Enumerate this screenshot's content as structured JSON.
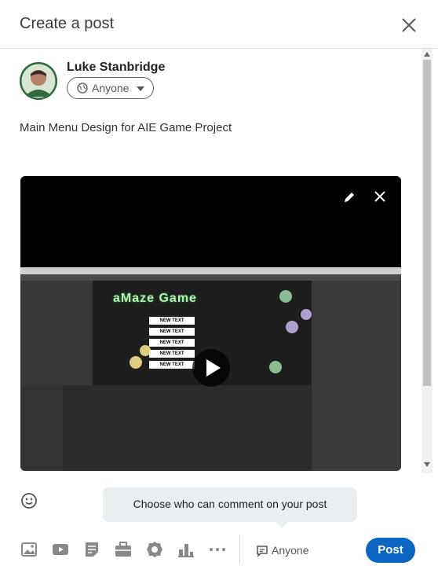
{
  "header": {
    "title": "Create a post"
  },
  "author": {
    "name": "Luke Stanbridge",
    "audience": "Anyone"
  },
  "post": {
    "text": "Main Menu Design for AIE Game Project"
  },
  "video": {
    "game_title": "aMaze Game",
    "menu_items": [
      "NEW TEXT",
      "NEW TEXT",
      "NEW TEXT",
      "NEW TEXT",
      "NEW TEXT"
    ]
  },
  "footer": {
    "tooltip": "Choose who can comment on your post",
    "comment_audience": "Anyone",
    "post_label": "Post"
  },
  "icons": [
    "close-icon",
    "globe-icon",
    "caret-down-icon",
    "pencil-icon",
    "remove-video-icon",
    "play-icon",
    "emoji-icon",
    "image-icon",
    "video-icon",
    "document-icon",
    "briefcase-icon",
    "badge-icon",
    "chart-icon",
    "more-icon",
    "comment-icon"
  ],
  "colors": {
    "accent": "#0a66c2",
    "avatar_ring": "#2f6b3a"
  }
}
